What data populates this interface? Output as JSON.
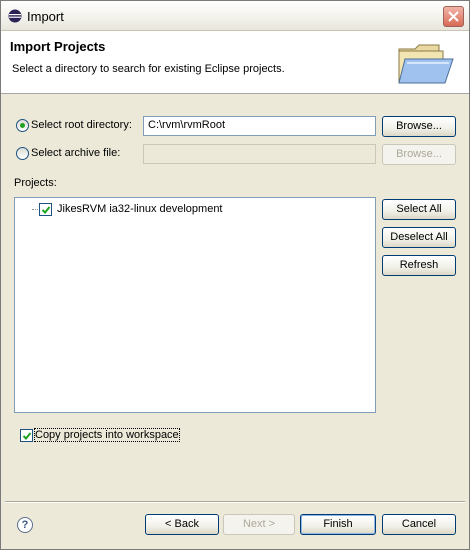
{
  "window": {
    "title": "Import"
  },
  "header": {
    "title": "Import Projects",
    "description": "Select a directory to search for existing Eclipse projects."
  },
  "source": {
    "root_label": "Select root directory:",
    "root_value": "C:\\rvm\\rvmRoot",
    "root_selected": true,
    "archive_label": "Select archive file:",
    "archive_value": "",
    "browse_label": "Browse...",
    "browse_archive_label": "Browse..."
  },
  "projects": {
    "label": "Projects:",
    "items": [
      {
        "name": "JikesRVM ia32-linux development",
        "checked": true
      }
    ],
    "select_all": "Select All",
    "deselect_all": "Deselect All",
    "refresh": "Refresh"
  },
  "options": {
    "copy_label": "Copy projects into workspace",
    "copy_checked": true
  },
  "footer": {
    "help": "?",
    "back": "< Back",
    "next": "Next >",
    "finish": "Finish",
    "cancel": "Cancel"
  }
}
